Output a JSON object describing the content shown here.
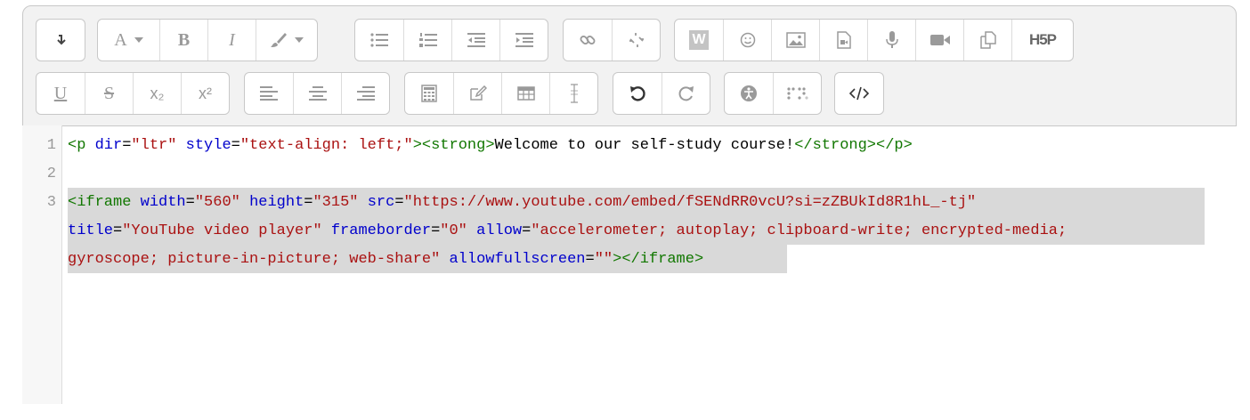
{
  "toolbar": {
    "rows": [
      [
        {
          "name": "collapse-group",
          "buttons": [
            {
              "icon": "collapse-icon",
              "label": "",
              "active": true
            }
          ]
        },
        {
          "name": "font-group",
          "buttons": [
            {
              "icon": "font-color-icon",
              "label": "A",
              "active": false
            },
            {
              "icon": "bold-icon",
              "label": "B",
              "active": false
            },
            {
              "icon": "italic-icon",
              "label": "I",
              "active": false
            },
            {
              "icon": "background-color-icon",
              "label": "",
              "active": false
            }
          ]
        },
        {
          "name": "list-group",
          "buttons": [
            {
              "icon": "unordered-list-icon",
              "label": "",
              "active": false
            },
            {
              "icon": "ordered-list-icon",
              "label": "",
              "active": false
            },
            {
              "icon": "outdent-icon",
              "label": "",
              "active": false
            },
            {
              "icon": "indent-icon",
              "label": "",
              "active": false
            }
          ]
        },
        {
          "name": "link-group",
          "buttons": [
            {
              "icon": "link-icon",
              "label": "",
              "active": false
            },
            {
              "icon": "unlink-icon",
              "label": "",
              "active": false
            }
          ]
        },
        {
          "name": "insert-group",
          "buttons": [
            {
              "icon": "word-paste-icon",
              "label": "W",
              "active": false
            },
            {
              "icon": "emoji-icon",
              "label": "",
              "active": false
            },
            {
              "icon": "image-icon",
              "label": "",
              "active": false
            },
            {
              "icon": "media-icon",
              "label": "",
              "active": false
            },
            {
              "icon": "microphone-icon",
              "label": "",
              "active": false
            },
            {
              "icon": "video-camera-icon",
              "label": "",
              "active": false
            },
            {
              "icon": "manage-files-icon",
              "label": "",
              "active": false
            },
            {
              "icon": "h5p-icon",
              "label": "H5P",
              "active": false
            }
          ]
        }
      ],
      [
        {
          "name": "format-group",
          "buttons": [
            {
              "icon": "underline-icon",
              "label": "U",
              "active": false
            },
            {
              "icon": "strikethrough-icon",
              "label": "S",
              "active": false
            },
            {
              "icon": "subscript-icon",
              "label": "x₂",
              "active": false
            },
            {
              "icon": "superscript-icon",
              "label": "x²",
              "active": false
            }
          ]
        },
        {
          "name": "align-group",
          "buttons": [
            {
              "icon": "align-left-icon",
              "label": "",
              "active": false
            },
            {
              "icon": "align-center-icon",
              "label": "",
              "active": false
            },
            {
              "icon": "align-right-icon",
              "label": "",
              "active": false
            }
          ]
        },
        {
          "name": "tools-group",
          "buttons": [
            {
              "icon": "equation-icon",
              "label": "",
              "active": false
            },
            {
              "icon": "special-char-icon",
              "label": "",
              "active": false
            },
            {
              "icon": "table-icon",
              "label": "",
              "active": false
            },
            {
              "icon": "clear-format-icon",
              "label": "",
              "active": false
            }
          ]
        },
        {
          "name": "history-group",
          "buttons": [
            {
              "icon": "undo-icon",
              "label": "",
              "active": true
            },
            {
              "icon": "redo-icon",
              "label": "",
              "active": false
            }
          ]
        },
        {
          "name": "accessibility-group",
          "buttons": [
            {
              "icon": "accessibility-checker-icon",
              "label": "",
              "active": false
            },
            {
              "icon": "screenreader-helper-icon",
              "label": "",
              "active": false
            }
          ]
        },
        {
          "name": "html-group",
          "buttons": [
            {
              "icon": "html-source-icon",
              "label": "",
              "active": true
            }
          ]
        }
      ]
    ]
  },
  "code": {
    "line_numbers": [
      "1",
      "2",
      "3"
    ],
    "line1": [
      "<p ",
      "dir",
      "=",
      "\"ltr\"",
      " ",
      "style",
      "=",
      "\"text-align: left;\"",
      "><strong>",
      "Welcome to our self-study course!",
      "</strong></p>"
    ],
    "line3a": [
      "<iframe ",
      "width",
      "=",
      "\"560\"",
      " ",
      "height",
      "=",
      "\"315\"",
      " ",
      "src",
      "=",
      "\"https://www.youtube.com/embed/fSENdRR0vcU?si=zZBUkId8R1hL_-tj\""
    ],
    "line3b": [
      "title",
      "=",
      "\"YouTube video player\"",
      " ",
      "frameborder",
      "=",
      "\"0\"",
      " ",
      "allow",
      "=",
      "\"accelerometer; autoplay; clipboard-write; encrypted-media;"
    ],
    "line3c": [
      "gyroscope; picture-in-picture; web-share\"",
      " ",
      "allowfullscreen",
      "=",
      "\"\"",
      "></iframe>"
    ]
  },
  "colors": {
    "tag": "#117700",
    "attribute": "#0000cc",
    "string": "#aa1111",
    "selection": "#d9d9d9"
  }
}
